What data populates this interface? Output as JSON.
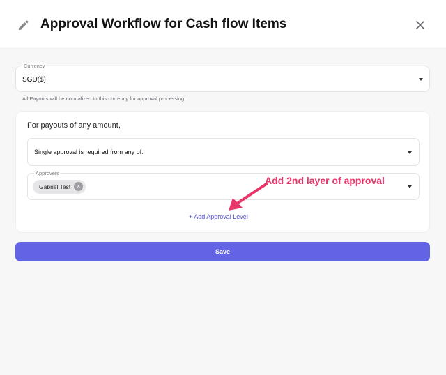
{
  "dialog": {
    "title": "Approval Workflow for Cash flow Items",
    "icons": {
      "edit": "pencil-icon",
      "close": "close-icon"
    }
  },
  "currency": {
    "label": "Currency",
    "value": "SGD($)",
    "helper_text": "All Payouts will be normalized to this currency for approval processing."
  },
  "rule_card": {
    "heading": "For payouts of any amount,",
    "approval_type": "Single approval is required from any of:",
    "approvers_label": "Approvers",
    "approvers": [
      {
        "name": "Gabriel Test"
      }
    ],
    "add_level_label": "+ Add Approval Level"
  },
  "actions": {
    "save_label": "Save"
  },
  "annotation": {
    "text": "Add 2nd layer of approval",
    "color": "#e8356a"
  },
  "colors": {
    "accent": "#6363e6",
    "link": "#4f4fd0"
  }
}
